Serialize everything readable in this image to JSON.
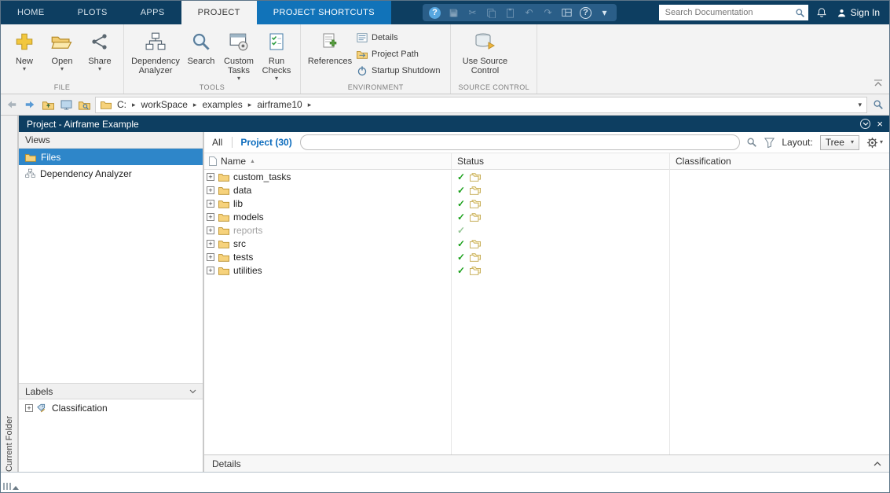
{
  "colors": {
    "titlebar_navy": "#0d3e61",
    "shortcut_tab_blue": "#1173b9",
    "selection_blue": "#2e86c9",
    "link_blue": "#0b6bbd",
    "check_green": "#1ca11c",
    "folder_yellow": "#f6d27c"
  },
  "tabs": [
    {
      "id": "home",
      "label": "HOME"
    },
    {
      "id": "plots",
      "label": "PLOTS"
    },
    {
      "id": "apps",
      "label": "APPS"
    },
    {
      "id": "project",
      "label": "PROJECT",
      "state": "active"
    },
    {
      "id": "project-shortcuts",
      "label": "PROJECT SHORTCUTS",
      "state": "highlight"
    }
  ],
  "quick_access": {
    "doc_search_placeholder": "Search Documentation",
    "sign_in_label": "Sign In"
  },
  "ribbon": {
    "sections": {
      "file": "FILE",
      "tools": "TOOLS",
      "environment": "ENVIRONMENT",
      "source_control": "SOURCE CONTROL"
    },
    "buttons": {
      "new": "New",
      "open": "Open",
      "share": "Share",
      "dependency_analyzer": "Dependency Analyzer",
      "search": "Search",
      "custom_tasks": "Custom Tasks",
      "run_checks": "Run Checks",
      "references": "References",
      "details": "Details",
      "project_path": "Project Path",
      "startup_shutdown": "Startup Shutdown",
      "use_source_control": "Use Source Control"
    }
  },
  "address_bar": {
    "drive": "C:",
    "segments": [
      "workSpace",
      "examples",
      "airframe10"
    ]
  },
  "current_folder_strip": {
    "label": "Current Folder"
  },
  "project_panel": {
    "title": "Project - Airframe Example",
    "views": {
      "title": "Views",
      "items": [
        {
          "id": "files",
          "label": "Files",
          "selected": true
        },
        {
          "id": "dependency-analyzer",
          "label": "Dependency Analyzer",
          "selected": false
        }
      ]
    },
    "labels_section": {
      "title": "Labels",
      "items": [
        {
          "id": "classification",
          "label": "Classification"
        }
      ]
    },
    "filter_bar": {
      "all_label": "All",
      "project_label": "Project (30)",
      "search_value": "",
      "layout_label": "Layout:",
      "layout_value": "Tree"
    },
    "table": {
      "columns": [
        "Name",
        "Status",
        "Classification"
      ],
      "rows": [
        {
          "name": "custom_tasks",
          "checked": true,
          "status_icon": true,
          "muted": false
        },
        {
          "name": "data",
          "checked": true,
          "status_icon": true,
          "muted": false
        },
        {
          "name": "lib",
          "checked": true,
          "status_icon": true,
          "muted": false
        },
        {
          "name": "models",
          "checked": true,
          "status_icon": true,
          "muted": false
        },
        {
          "name": "reports",
          "checked": true,
          "status_icon": false,
          "muted": true
        },
        {
          "name": "src",
          "checked": true,
          "status_icon": true,
          "muted": false
        },
        {
          "name": "tests",
          "checked": true,
          "status_icon": true,
          "muted": false
        },
        {
          "name": "utilities",
          "checked": true,
          "status_icon": true,
          "muted": false
        }
      ]
    },
    "details_bar": {
      "label": "Details"
    }
  }
}
